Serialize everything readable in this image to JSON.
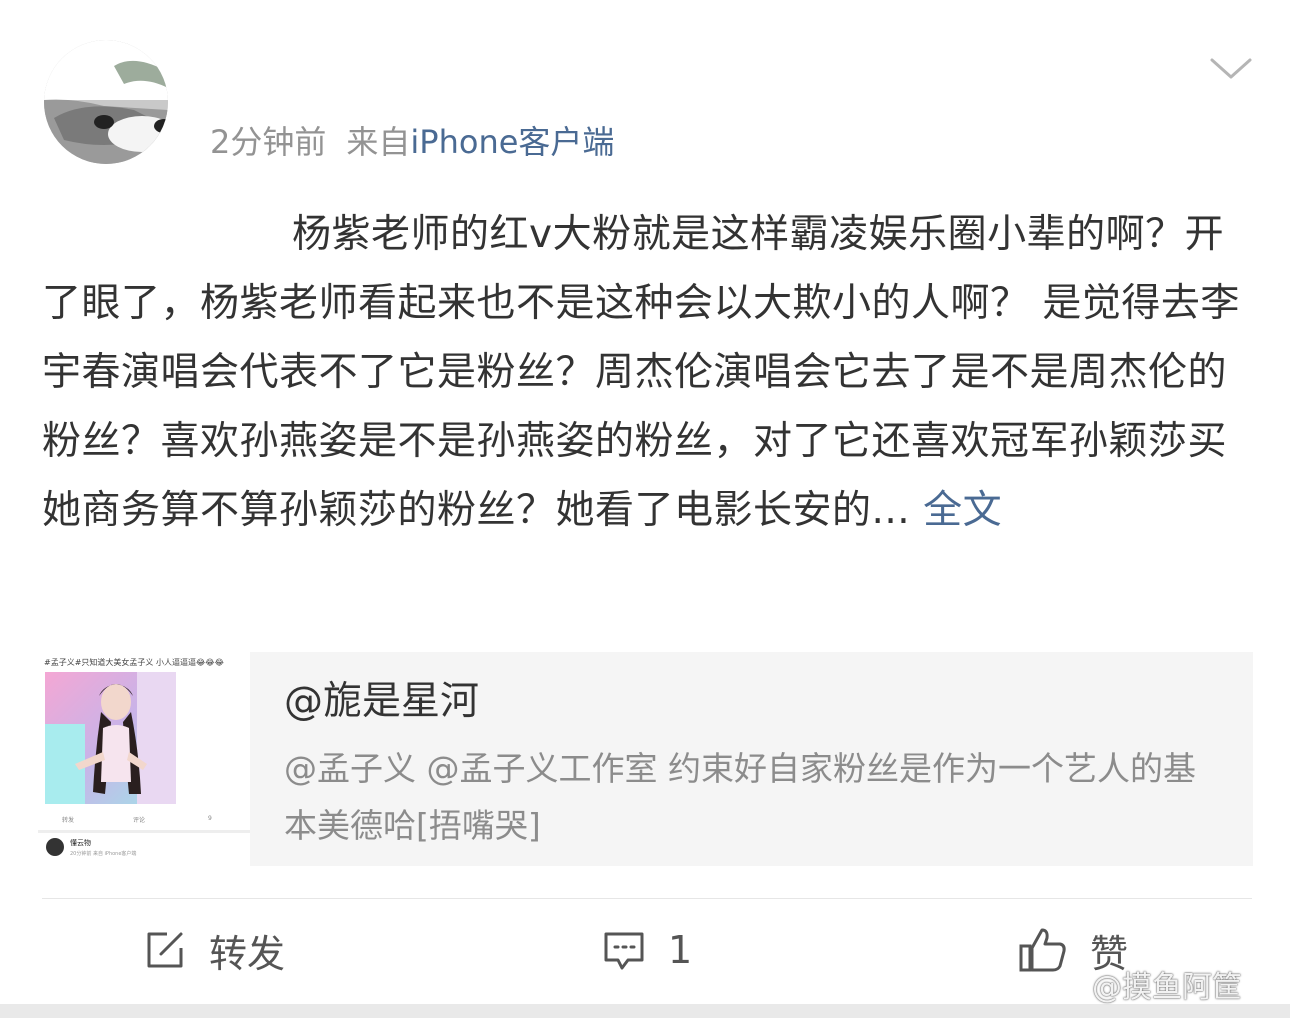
{
  "post": {
    "meta": {
      "time": "2分钟前",
      "source_prefix": "来自",
      "source_link": "iPhone客户端"
    },
    "body_text": "杨紫老师的红v大粉就是这样霸凌娱乐圈小辈的啊？开了眼了，杨紫老师看起来也不是这种会以大欺小的人啊？ 是觉得去李宇春演唱会代表不了它是粉丝？周杰伦演唱会它去了是不是周杰伦的粉丝？喜欢孙燕姿是不是孙燕姿的粉丝，对了它还喜欢冠军孙颖莎买她商务算不算孙颖莎的粉丝？她看了电影长安的...",
    "full_text_link": "全文"
  },
  "repost": {
    "author": "@旎是星河",
    "text": "@孟子义 @孟子义工作室 约束好自家粉丝是作为一个艺人的基本美德哈[捂嘴哭]",
    "thumbnail": {
      "caption": "#孟子义#只知道大美女孟子义 小人逼逼逼😂😂😂",
      "actions": [
        "转发",
        "评论",
        "9"
      ],
      "user_name": "懂云物",
      "user_meta": "20分钟前 来自 iPhone客户端"
    }
  },
  "actions": {
    "repost_label": "转发",
    "comment_count": "1",
    "like_label": "赞"
  },
  "watermark": "@摸鱼阿筐",
  "colors": {
    "link": "#4a6a93",
    "text": "#333333",
    "meta": "#939393",
    "card_bg": "#f5f5f5"
  },
  "icons": {
    "repost": "edit-square-icon",
    "comment": "comment-bubble-icon",
    "like": "thumbs-up-icon",
    "menu": "chevron-down-icon"
  }
}
